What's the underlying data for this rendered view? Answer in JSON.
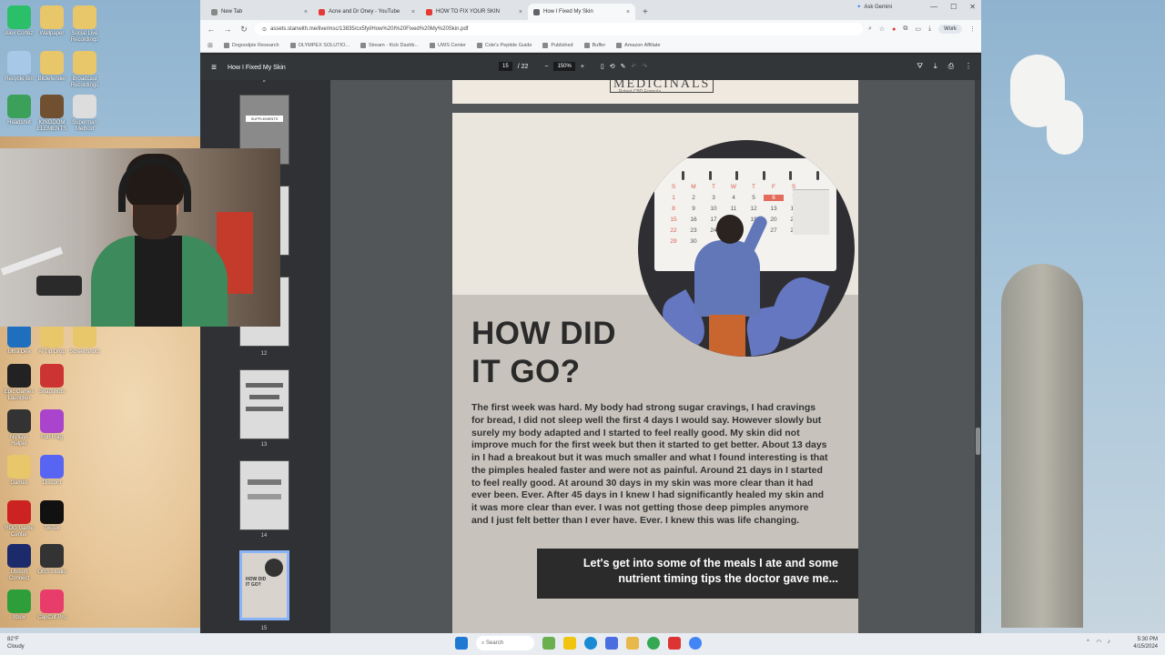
{
  "browser": {
    "tabs": [
      {
        "label": "New Tab",
        "color": "#888888"
      },
      {
        "label": "Acne and Dr Oney - YouTube",
        "color": "#e53935"
      },
      {
        "label": "HOW TO FIX YOUR SKIN",
        "color": "#e53935"
      },
      {
        "label": "How I Fixed My Skin",
        "color": "#5f6368"
      }
    ],
    "new_tab_icon": "+",
    "ask_gemini": "Ask Gemini",
    "url": "assets.stanwith.me/live/msc/13835/cx5fyl/How%20I%20Fixed%20My%20Skin.pdf",
    "profile_label": "Work",
    "bookmarks": [
      "Dogoodpie Research",
      "OLYMPEX SOLUTIO...",
      "Stream - Kick Dashb...",
      "UWS Center",
      "Cole's Peptide Guide",
      "Published",
      "Buffer",
      "Amazon Affiliate"
    ]
  },
  "pdf": {
    "doc_title": "How I Fixed My Skin",
    "page_current": "15",
    "page_total": "/ 22",
    "zoom": "150%",
    "minus": "−",
    "plus": "+"
  },
  "thumbnails": [
    {
      "label": "9"
    },
    {
      "label": "12"
    },
    {
      "label": "13"
    },
    {
      "label": "14"
    },
    {
      "label": "15"
    }
  ],
  "thumb_texts": {
    "supplements": "SUPPLEMENTS",
    "how_did": "HOW DID IT GO?"
  },
  "page": {
    "logo": "MEDICINALS",
    "logo_sub": "Potent CBD Formula",
    "calendar_days_header": [
      "S",
      "M",
      "T",
      "W",
      "T",
      "F",
      "S"
    ],
    "calendar_rows": [
      [
        "1",
        "2",
        "3",
        "4",
        "5",
        "6",
        "7"
      ],
      [
        "8",
        "9",
        "10",
        "11",
        "12",
        "13",
        "14"
      ],
      [
        "15",
        "16",
        "17",
        "18",
        "19",
        "20",
        "21"
      ],
      [
        "22",
        "23",
        "24",
        "25",
        "26",
        "27",
        "28"
      ],
      [
        "29",
        "30",
        "",
        "",
        "",
        "",
        ""
      ]
    ],
    "title_line1": "HOW DID",
    "title_line2": "IT GO?",
    "body": "The first week was hard. My body had strong sugar cravings, I had cravings for bread, I did not sleep well the first 4 days I would say. However slowly but surely my body adapted and I started to feel really good. My skin did not improve much for the first week but then it started to get better. About 13 days in I had a breakout but it was much smaller and what I found interesting is that the pimples healed faster and were not as painful. Around 21 days in I started to feel really good. At around 30 days in my skin was more clear than it had ever been. Ever. After 45 days in I knew I had significantly healed my skin and it was more clear than ever. I was not getting those deep pimples anymore and I just felt better than I ever have. Ever. I knew this was life changing.",
    "cta_line1": "Let's get into some of the meals I ate and some",
    "cta_line2": "nutrient timing tips the doctor gave me..."
  },
  "desktop_icons": [
    {
      "label": "Alex Cortez",
      "color": "#2bbf6a"
    },
    {
      "label": "Wallpaper",
      "color": "#e8c66a"
    },
    {
      "label": "Social Live Recordings",
      "color": "#e8c66a"
    },
    {
      "label": "Recycle Bin",
      "color": "#a8c8e8"
    },
    {
      "label": "Bitdefender",
      "color": "#e8c66a"
    },
    {
      "label": "Broadcast Recordings",
      "color": "#e8c66a"
    },
    {
      "label": "Headshot",
      "color": "#3aa05a"
    },
    {
      "label": "KINGDOM ELEMENTS",
      "color": "#705030"
    },
    {
      "label": "Superman Method",
      "color": "#dddddd"
    },
    {
      "label": "Ultra Dev",
      "color": "#1f6fbf"
    },
    {
      "label": "Al Tip Drop",
      "color": "#e8c66a"
    },
    {
      "label": "Screenshots",
      "color": "#e8c66a"
    },
    {
      "label": "Epic Games Launcher",
      "color": "#222222"
    },
    {
      "label": "Snapshots",
      "color": "#cc3333"
    },
    {
      "label": "NVIDIA Helper",
      "color": "#333333"
    },
    {
      "label": "Full Frag",
      "color": "#aa44cc"
    },
    {
      "label": "Games",
      "color": "#e8c66a"
    },
    {
      "label": "Discord",
      "color": "#5865f2"
    },
    {
      "label": "ROG Game Center",
      "color": "#cc2222"
    },
    {
      "label": "TikTok",
      "color": "#111111"
    },
    {
      "label": "Ubisoft Connect",
      "color": "#1b2a6b"
    },
    {
      "label": "OBS Studio",
      "color": "#333333"
    },
    {
      "label": "Xbox",
      "color": "#2e9e3a"
    },
    {
      "label": "CapCut Pro",
      "color": "#e83c6a"
    }
  ],
  "taskbar": {
    "weather_temp": "82°F",
    "weather_desc": "Cloudy",
    "search_placeholder": "Search",
    "time": "5:30 PM",
    "date": "4/15/2024"
  },
  "colors": {
    "pdf_toolbar": "#323639",
    "viewer_bg": "#525659",
    "page_bg": "#c7c2bb",
    "cta_bg": "#2b2b2b",
    "accent_blue": "#8ab4f8"
  }
}
